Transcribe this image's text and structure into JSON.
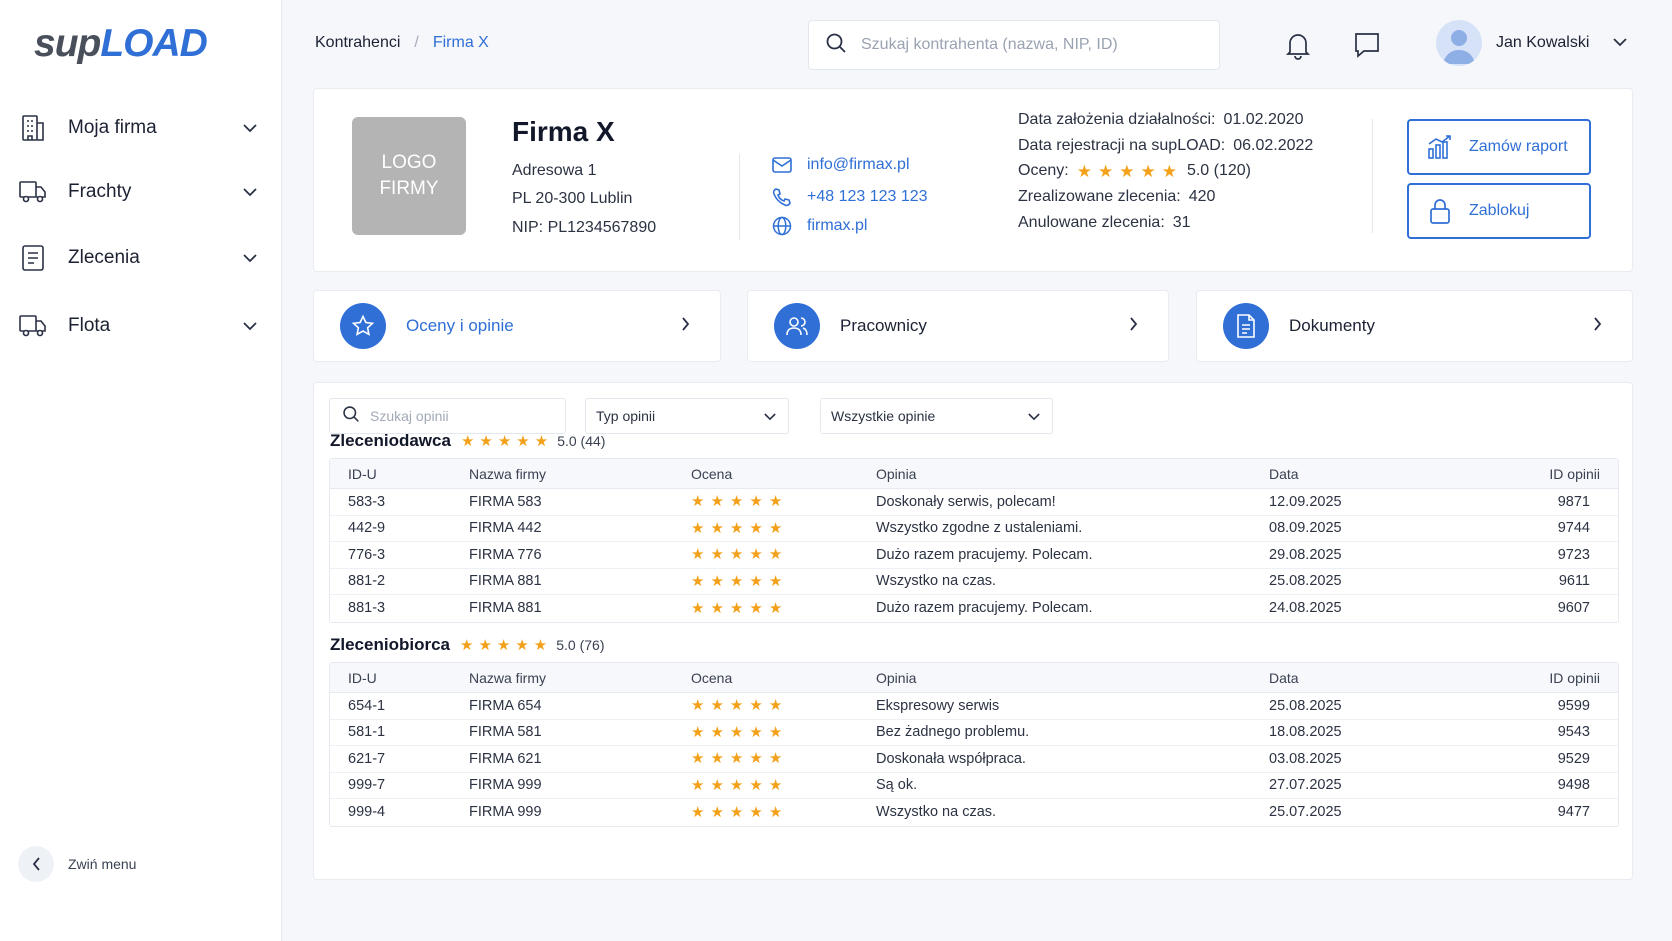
{
  "sidebar": {
    "logo_part1": "sup",
    "logo_part2": "LOAD",
    "items": [
      {
        "label": "Moja firma",
        "icon": "building-icon"
      },
      {
        "label": "Frachty",
        "icon": "truck-icon"
      },
      {
        "label": "Zlecenia",
        "icon": "document-icon"
      },
      {
        "label": "Flota",
        "icon": "truck-icon"
      }
    ],
    "collapse_label": "Zwiń menu"
  },
  "header": {
    "breadcrumb": [
      "Kontrahenci",
      "Firma X"
    ],
    "breadcrumb_sep": "/",
    "search_placeholder": "Szukaj kontrahenta (nazwa, NIP, ID)",
    "user_name": "Jan Kowalski"
  },
  "company": {
    "logo_text_1": "LOGO",
    "logo_text_2": "FIRMY",
    "name": "Firma X",
    "address_1": "Adresowa 1",
    "address_2": "PL 20-300 Lublin",
    "nip": "NIP: PL1234567890",
    "email": "info@firmax.pl",
    "phone": "+48 123 123 123",
    "website": "firmax.pl",
    "founded_label": "Data założenia działalności:",
    "founded_value": "01.02.2020",
    "registered_label": "Data rejestracji na supLOAD:",
    "registered_value": "06.02.2022",
    "ratings_label": "Oceny:",
    "ratings_value": "5.0 (120)",
    "ratings_stars": 5,
    "completed_label": "Zrealizowane zlecenia:",
    "completed_value": "420",
    "cancelled_label": "Anulowane zlecenia:",
    "cancelled_value": "31",
    "order_report_label": "Zamów raport",
    "block_label": "Zablokuj"
  },
  "tabs": [
    {
      "label": "Oceny i opinie",
      "icon": "star-icon",
      "active": true
    },
    {
      "label": "Pracownicy",
      "icon": "users-icon",
      "active": false
    },
    {
      "label": "Dokumenty",
      "icon": "file-icon",
      "active": false
    }
  ],
  "opinions": {
    "search_placeholder": "Szukaj opinii",
    "type_select": "Typ opinii",
    "all_select": "Wszystkie opinie",
    "columns": [
      "ID-U",
      "Nazwa firmy",
      "Ocena",
      "Opinia",
      "Data",
      "ID opinii"
    ],
    "sections": [
      {
        "title": "Zleceniodawca",
        "rating": "5.0 (44)",
        "stars": 5,
        "rows": [
          {
            "idu": "583-3",
            "company": "FIRMA 583",
            "stars": 5,
            "opinion": "Doskonały serwis, polecam!",
            "date": "12.09.2025",
            "id": "9871"
          },
          {
            "idu": "442-9",
            "company": "FIRMA 442",
            "stars": 5,
            "opinion": "Wszystko zgodne z ustaleniami.",
            "date": "08.09.2025",
            "id": "9744"
          },
          {
            "idu": "776-3",
            "company": "FIRMA 776",
            "stars": 5,
            "opinion": "Dużo razem pracujemy. Polecam.",
            "date": "29.08.2025",
            "id": "9723"
          },
          {
            "idu": "881-2",
            "company": "FIRMA 881",
            "stars": 5,
            "opinion": "Wszystko na czas.",
            "date": "25.08.2025",
            "id": "9611"
          },
          {
            "idu": "881-3",
            "company": "FIRMA 881",
            "stars": 5,
            "opinion": "Dużo razem pracujemy. Polecam.",
            "date": "24.08.2025",
            "id": "9607"
          }
        ]
      },
      {
        "title": "Zleceniobiorca",
        "rating": "5.0 (76)",
        "stars": 5,
        "rows": [
          {
            "idu": "654-1",
            "company": "FIRMA 654",
            "stars": 5,
            "opinion": "Ekspresowy serwis",
            "date": "25.08.2025",
            "id": "9599"
          },
          {
            "idu": "581-1",
            "company": "FIRMA 581",
            "stars": 5,
            "opinion": "Bez żadnego problemu.",
            "date": "18.08.2025",
            "id": "9543"
          },
          {
            "idu": "621-7",
            "company": "FIRMA 621",
            "stars": 5,
            "opinion": "Doskonała współpraca.",
            "date": "03.08.2025",
            "id": "9529"
          },
          {
            "idu": "999-7",
            "company": "FIRMA 999",
            "stars": 5,
            "opinion": "Są ok.",
            "date": "27.07.2025",
            "id": "9498"
          },
          {
            "idu": "999-4",
            "company": "FIRMA 999",
            "stars": 5,
            "opinion": "Wszystko na czas.",
            "date": "25.07.2025",
            "id": "9477"
          }
        ]
      }
    ]
  },
  "colors": {
    "accent": "#2f6fd6",
    "star": "#f3a11b"
  }
}
